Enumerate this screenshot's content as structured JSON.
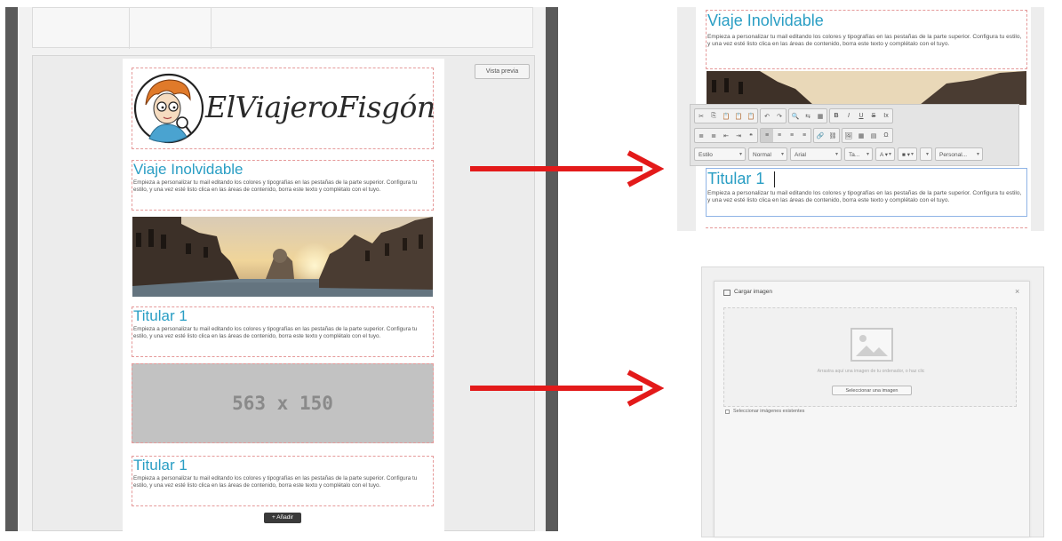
{
  "editor": {
    "preview_button": "Vista previa",
    "logo_text": "ElViajeroFisgón",
    "blocks": [
      {
        "title": "Viaje Inolvidable",
        "text": "Empieza a personalizar tu mail editando los colores y tipografías en las pestañas de la parte superior. Configura tu estilo, y una vez esté listo clica en las áreas de contenido, borra este texto y complétalo con el tuyo."
      },
      {
        "title": "Titular 1",
        "text": "Empieza a personalizar tu mail editando los colores y tipografías en las pestañas de la parte superior. Configura tu estilo, y una vez esté listo clica en las áreas de contenido, borra este texto y complétalo con el tuyo."
      },
      {
        "title": "Titular 1",
        "text": "Empieza a personalizar tu mail editando los colores y tipografías en las pestañas de la parte superior. Configura tu estilo, y una vez esté listo clica en las áreas de contenido, borra este texto y complétalo con el tuyo."
      }
    ],
    "placeholder_label": "563 x 150",
    "add_button": "+ Añadir"
  },
  "rich_editor": {
    "title": "Viaje Inolvidable",
    "text": "Empieza a personalizar tu mail editando los colores y tipografías en las pestañas de la parte superior. Configura tu estilo, y una vez esté listo clica en las áreas de contenido, borra este texto y complétalo con el tuyo.",
    "active_title": "Titular 1",
    "active_text": "Empieza a personalizar tu mail editando los colores y tipografías en las pestañas de la parte superior. Configura tu estilo, y una vez esté listo clica en las áreas de contenido, borra este texto y complétalo con el tuyo.",
    "toolbar_row1": [
      "✂",
      "⎘",
      "📋",
      "📋",
      "📋",
      "↶",
      "↷",
      "🔍",
      "⇆",
      "▦",
      "B",
      "I",
      "U",
      "S",
      "Ix"
    ],
    "toolbar_row2": [
      "≣",
      "≣",
      "⇤",
      "⇥",
      "❝",
      "≡",
      "≡",
      "≡",
      "≡",
      "🔗",
      "⛓",
      "🖼",
      "▦",
      "▤",
      "Ω"
    ],
    "toolbar_selects": [
      "Estilo",
      "Normal",
      "Arial",
      "Ta..."
    ],
    "toolbar_color_buttons": [
      "A ▾",
      "■ ▾"
    ],
    "toolbar_extra": "Personal..."
  },
  "image_dialog": {
    "title": "Cargar imagen",
    "close": "×",
    "drop_hint": "Arrastra aquí una imagen de tu ordenador, o haz clic",
    "select_button": "Seleccionar una imagen",
    "existing_label": "Seleccionar imágenes existentes"
  },
  "colors": {
    "accent": "#2a9ec4",
    "arrow": "#e31a1a",
    "dashed_border": "#e59a9a",
    "placeholder": "#c2c2c2"
  }
}
